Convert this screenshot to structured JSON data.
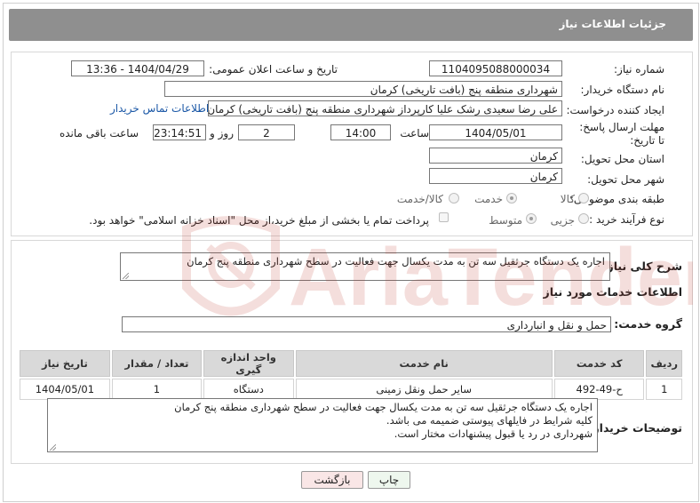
{
  "header": {
    "title": "جزئیات اطلاعات نیاز"
  },
  "form": {
    "need_number": {
      "label": "شماره نیاز:",
      "value": "1104095088000034"
    },
    "announce": {
      "label": "تاریخ و ساعت اعلان عمومی:",
      "value": "1404/04/29 - 13:36"
    },
    "buyer_org": {
      "label": "نام دستگاه خریدار:",
      "value": "شهرداری منطقه پنج (بافت تاریخی) کرمان"
    },
    "creator": {
      "label": "ایجاد کننده درخواست:",
      "value": "علی رضا سعیدی رشک علیا کارپرداز شهرداری منطقه پنج (بافت تاریخی) کرمان",
      "contact_link": "اطلاعات تماس خریدار"
    },
    "deadline": {
      "label": "مهلت ارسال پاسخ: تا تاریخ:",
      "date": "1404/05/01",
      "time_label": "ساعت",
      "time": "14:00",
      "days": "2",
      "days_label": "روز و",
      "remaining": "23:14:51",
      "remaining_label": "ساعت باقی مانده"
    },
    "province": {
      "label": "استان محل تحویل:",
      "value": "کرمان"
    },
    "city": {
      "label": "شهر محل تحویل:",
      "value": "کرمان"
    },
    "category": {
      "label": "طبقه بندی موضوعی:",
      "options": [
        "کالا",
        "خدمت",
        "کالا/خدمت"
      ],
      "selected": "خدمت"
    },
    "purchase_type": {
      "label": "نوع فرآیند خرید :",
      "options": [
        "جزیی",
        "متوسط"
      ],
      "selected": "جزیی",
      "payment_note": "پرداخت تمام یا بخشی از مبلغ خرید،از محل \"اسناد خزانه اسلامی\" خواهد بود."
    }
  },
  "summary": {
    "label": "شرح کلی نیاز:",
    "value": "اجاره یک دستگاه جرثقیل سه تن به مدت یکسال جهت فعالیت در سطح شهرداری منطقه پنج کرمان"
  },
  "services": {
    "title": "اطلاعات خدمات مورد نیاز",
    "group_label": "گروه خدمت:",
    "group_value": "حمل و نقل و انبارداری",
    "columns": [
      "ردیف",
      "کد خدمت",
      "نام خدمت",
      "واحد اندازه گیری",
      "تعداد / مقدار",
      "تاریخ نیاز"
    ],
    "rows": [
      [
        "1",
        "ح-49-492",
        "سایر حمل ونقل زمینی",
        "دستگاه",
        "1",
        "1404/05/01"
      ]
    ]
  },
  "buyer_notes": {
    "label": "توضیحات خریدار:",
    "lines": [
      "اجاره یک دستگاه جرثقیل سه تن به مدت یکسال جهت فعالیت در سطح شهرداری منطقه پنج کرمان",
      "کلیه شرایط در فایلهای پیوستی ضمیمه می باشد.",
      "شهرداری در رد یا قبول پیشنهادات مختار است."
    ]
  },
  "actions": {
    "print": "چاپ",
    "back": "بازگشت"
  },
  "watermark": {
    "text": "AriaTender.neT",
    "color": "#c0392b"
  }
}
